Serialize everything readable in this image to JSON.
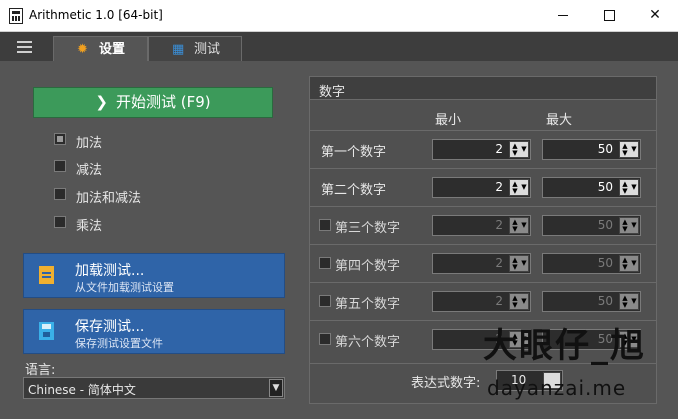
{
  "window": {
    "title": "Arithmetic 1.0  [64-bit]",
    "controls": {
      "minimize": "minimize-icon",
      "maximize": "maximize-icon",
      "close": "✕"
    }
  },
  "tabs": [
    {
      "label": "设置",
      "icon": "gear-icon",
      "active": true
    },
    {
      "label": "测试",
      "icon": "calculator-icon",
      "active": false
    }
  ],
  "start_button": {
    "label": "开始测试 (F9)",
    "arrow": "❯"
  },
  "operations": [
    {
      "label": "加法",
      "checked": true
    },
    {
      "label": "减法",
      "checked": false
    },
    {
      "label": "加法和减法",
      "checked": false
    },
    {
      "label": "乘法",
      "checked": false
    }
  ],
  "load_button": {
    "title": "加载测试...",
    "subtitle": "从文件加载测试设置"
  },
  "save_button": {
    "title": "保存测试...",
    "subtitle": "保存测试设置文件"
  },
  "language": {
    "label": "语言:",
    "value": "Chinese  -  简体中文"
  },
  "numbers_panel": {
    "title": "数字",
    "col_min": "最小",
    "col_max": "最大",
    "rows": [
      {
        "label": "第一个数字",
        "min": "2",
        "max": "50",
        "enabled": true,
        "has_checkbox": false
      },
      {
        "label": "第二个数字",
        "min": "2",
        "max": "50",
        "enabled": true,
        "has_checkbox": false
      },
      {
        "label": "第三个数字",
        "min": "2",
        "max": "50",
        "enabled": false,
        "has_checkbox": true
      },
      {
        "label": "第四个数字",
        "min": "2",
        "max": "50",
        "enabled": false,
        "has_checkbox": true
      },
      {
        "label": "第五个数字",
        "min": "2",
        "max": "50",
        "enabled": false,
        "has_checkbox": true
      },
      {
        "label": "第六个数字",
        "min": "2",
        "max": "50",
        "enabled": false,
        "has_checkbox": true
      }
    ],
    "expression_label": "表达式数字:",
    "expression_value": "10"
  },
  "watermark": {
    "cn": "大眼仔_旭",
    "en": "dayanzai.me"
  },
  "colors": {
    "background": "#555555",
    "start_button": "#3c9a5a",
    "action_button": "#2f64a8",
    "gear_icon": "#f0a020"
  }
}
